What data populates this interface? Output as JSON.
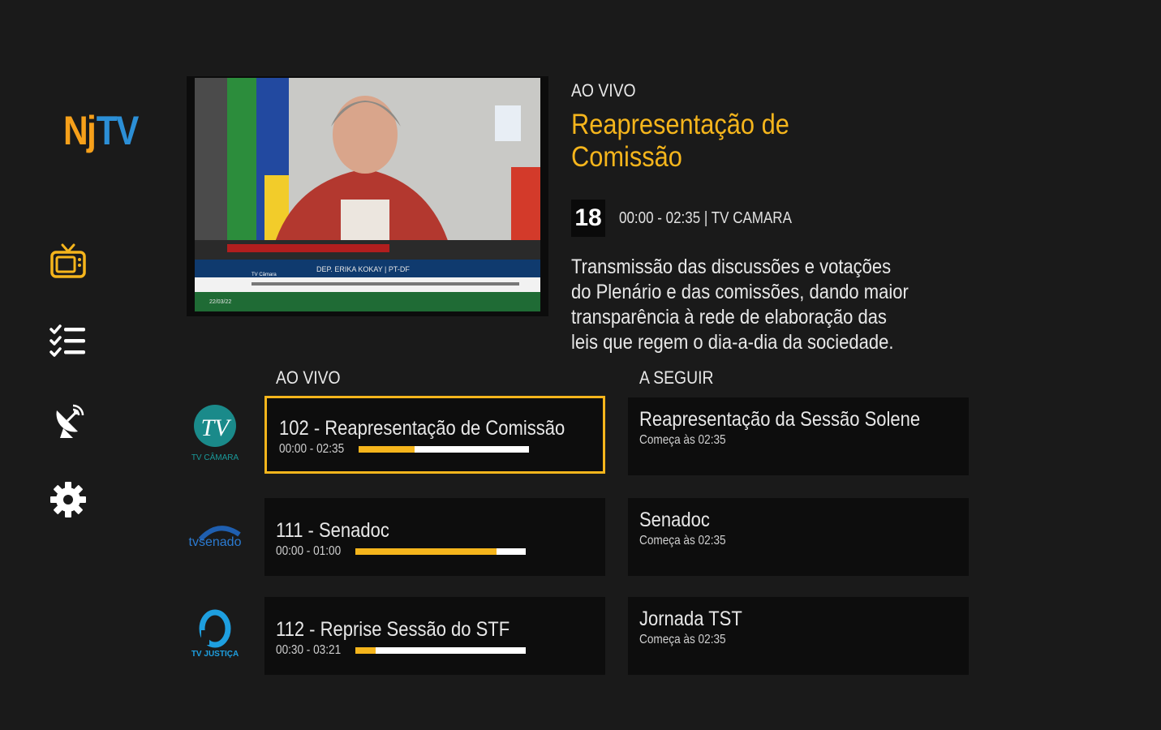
{
  "logo": {
    "part1": "Nj",
    "part2": "TV"
  },
  "nav": [
    {
      "name": "tv",
      "active": true
    },
    {
      "name": "list"
    },
    {
      "name": "satellite"
    },
    {
      "name": "settings"
    }
  ],
  "colors": {
    "accent": "#f5b51c",
    "background": "#1a1a1a",
    "card": "#0d0d0d",
    "logo_orange": "#f6a01a",
    "logo_blue": "#2c8fd6"
  },
  "preview": {
    "lower_third_name": "DEP. ERIKA KOKAY | PT-DF",
    "lower_third_left": "TV Câmara",
    "lower_third_date": "22/03/22"
  },
  "info": {
    "live_label": "AO VIVO",
    "title": "Reapresentação de Comissão",
    "day": "18",
    "time_channel": "00:00 - 02:35 | TV CAMARA",
    "description": "Transmissão das discussões e votações do Plenário e das comissões, dando maior transparência à rede de elaboração das leis que regem o dia-a-dia da sociedade."
  },
  "schedule": {
    "live_header": "AO VIVO",
    "next_header": "A SEGUIR",
    "rows": [
      {
        "channel_logo": "TV CÂMARA",
        "live": {
          "title": "102 - Reapresentação de Comissão",
          "time": "00:00 - 02:35",
          "progress": 0.33
        },
        "next": {
          "title": "Reapresentação da Sessão Solene",
          "sub": "Começa às 02:35"
        }
      },
      {
        "channel_logo": "tvsenado",
        "live": {
          "title": "111 - Senadoc",
          "time": "00:00 - 01:00",
          "progress": 0.83
        },
        "next": {
          "title": "Senadoc",
          "sub": "Começa às 02:35"
        }
      },
      {
        "channel_logo": "TV JUSTIÇA",
        "live": {
          "title": "112 - Reprise Sessão do STF",
          "time": "00:30 - 03:21",
          "progress": 0.12
        },
        "next": {
          "title": "Jornada TST",
          "sub": "Começa às 02:35"
        }
      }
    ]
  }
}
